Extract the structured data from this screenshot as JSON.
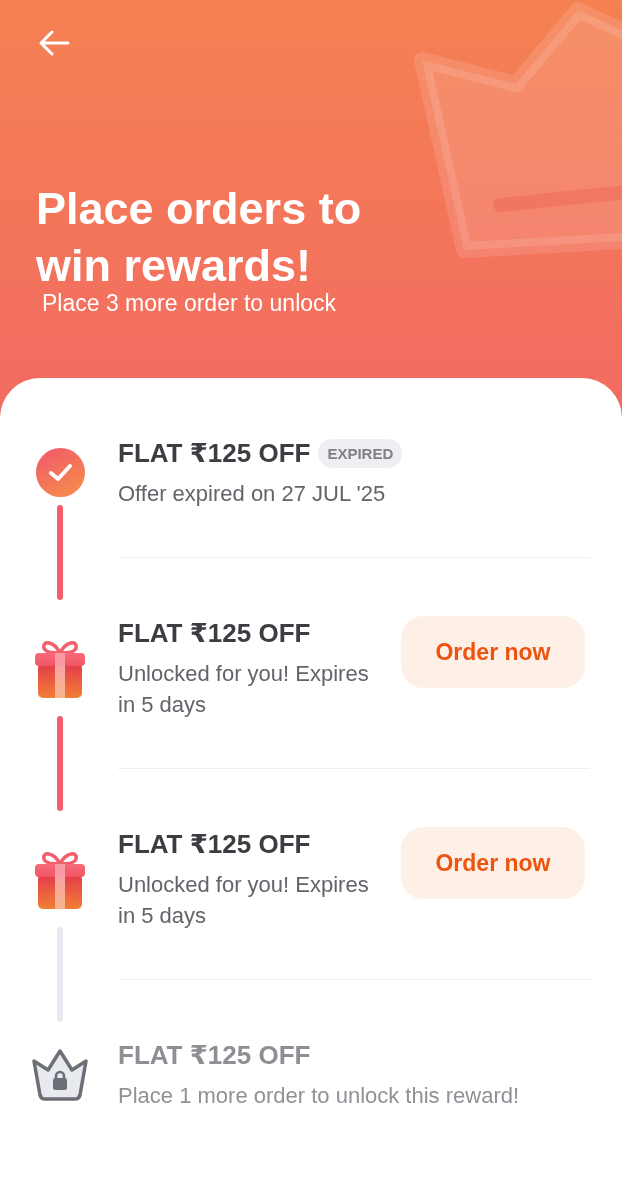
{
  "header": {
    "title": "Place orders to win rewards!",
    "subtitle": "Place 3 more order to unlock"
  },
  "rewards": [
    {
      "kind": "expired",
      "title": "FLAT ₹125 OFF",
      "badge": "EXPIRED",
      "subtitle": "Offer expired on 27 JUL '25"
    },
    {
      "kind": "unlocked",
      "title": "FLAT ₹125 OFF",
      "subtitle": "Unlocked for you! Expires in 5 days",
      "button": "Order now"
    },
    {
      "kind": "unlocked",
      "title": "FLAT ₹125 OFF",
      "subtitle": "Unlocked for you! Expires in 5 days",
      "button": "Order now"
    },
    {
      "kind": "locked",
      "title": "FLAT ₹125 OFF",
      "subtitle": "Place 1 more order to unlock this reward!"
    }
  ]
}
